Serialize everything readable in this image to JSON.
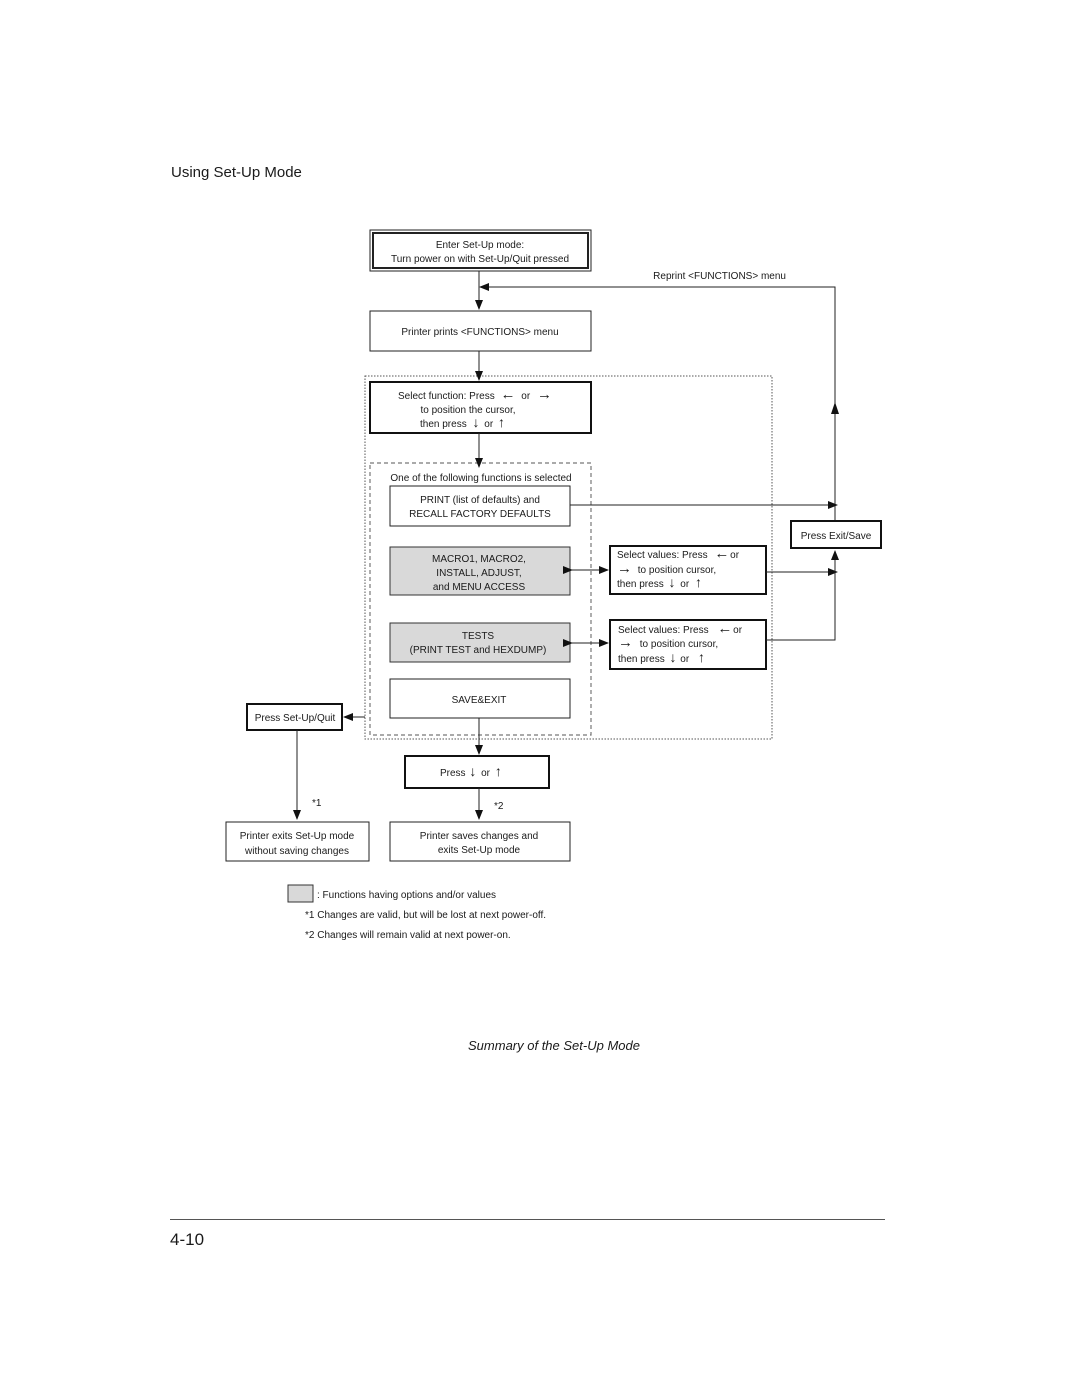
{
  "page": {
    "section_title": "Using Set-Up Mode",
    "caption": "Summary of the Set-Up Mode",
    "page_number": "4-10"
  },
  "diagram": {
    "enter": {
      "line1": "Enter Set-Up mode:",
      "line2": "Turn power on with Set-Up/Quit pressed"
    },
    "reprint_label": "Reprint <FUNCTIONS> menu",
    "prints_menu": "Printer prints <FUNCTIONS> menu",
    "select_function": {
      "line1_a": "Select function:  Press",
      "line1_b": "or",
      "line2": "to position the cursor,",
      "line3_a": "then press",
      "line3_b": "or"
    },
    "group_label": "One of the following functions is selected",
    "print_defaults": {
      "line1": "PRINT (list of defaults) and",
      "line2": "RECALL FACTORY DEFAULTS"
    },
    "macro": {
      "line1": "MACRO1, MACRO2,",
      "line2": "INSTALL, ADJUST,",
      "line3": "and MENU ACCESS"
    },
    "tests": {
      "line1": "TESTS",
      "line2": "(PRINT TEST and HEXDUMP)"
    },
    "save_exit": "SAVE&EXIT",
    "select_values_1": {
      "line1_a": "Select values:  Press",
      "line1_b": "or",
      "line2": "to position cursor,",
      "line3_a": "then press",
      "line3_b": "or"
    },
    "select_values_2": {
      "line1_a": "Select values:  Press",
      "line1_b": "or",
      "line2": "to position cursor,",
      "line3_a": "then press",
      "line3_b": "or"
    },
    "press_exit_save": "Press Exit/Save",
    "press_setup_quit": "Press Set-Up/Quit",
    "press_down_up": {
      "a": "Press",
      "b": "or"
    },
    "note1_marker": "*1",
    "note2_marker": "*2",
    "exit_no_save": {
      "line1": "Printer exits Set-Up mode",
      "line2": "without saving changes"
    },
    "save_and_exit": {
      "line1": "Printer saves changes and",
      "line2": "exits Set-Up mode"
    }
  },
  "legend": {
    "gray_box_text": ": Functions having options and/or values",
    "note1": "*1  Changes are valid, but will be lost at next power-off.",
    "note2": "*2  Changes will remain valid at next power-on."
  },
  "icons": {
    "left": "←",
    "right": "→",
    "down": "↓",
    "up": "↑"
  }
}
